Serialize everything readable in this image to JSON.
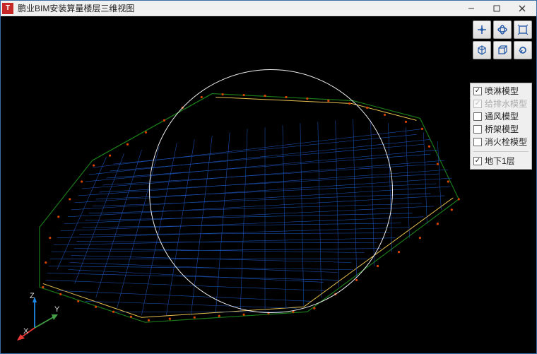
{
  "window": {
    "title": "鹏业BIM安装算量楼层三维视图"
  },
  "axis": {
    "x_label": "X",
    "y_label": "Y",
    "z_label": "Z",
    "x_color": "#e53935",
    "y_color": "#43a047",
    "z_color": "#1e88e5"
  },
  "tools": [
    {
      "name": "pan-icon"
    },
    {
      "name": "orbit-icon"
    },
    {
      "name": "zoom-extents-icon"
    },
    {
      "name": "iso-view-icon"
    },
    {
      "name": "box-view-icon"
    },
    {
      "name": "refresh-icon"
    }
  ],
  "layers": {
    "items": [
      {
        "label": "喷淋模型",
        "checked": true,
        "enabled": true
      },
      {
        "label": "给排水模型",
        "checked": true,
        "enabled": false
      },
      {
        "label": "通风模型",
        "checked": false,
        "enabled": true
      },
      {
        "label": "桥架模型",
        "checked": false,
        "enabled": true
      },
      {
        "label": "消火栓模型",
        "checked": false,
        "enabled": true
      }
    ],
    "floor": {
      "label": "地下1层",
      "checked": true
    }
  },
  "model": {
    "wire_color": "#1f59c4",
    "base_color": "#1a7a1a",
    "marker_color": "#d84400",
    "accent_color": "#e6c050"
  }
}
